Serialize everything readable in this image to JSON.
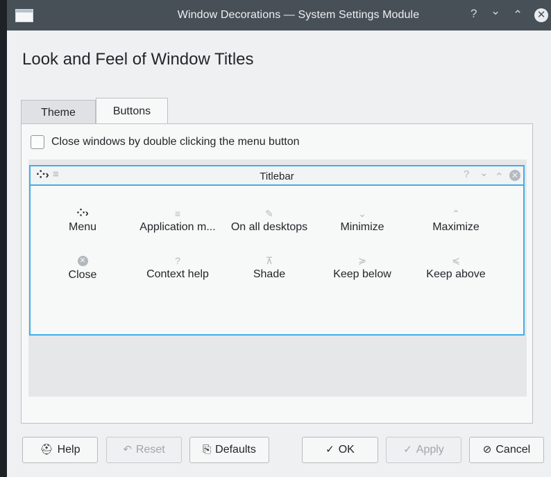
{
  "window": {
    "title": "Window Decorations — System Settings Module",
    "buttons": {
      "help": "?",
      "minimize": "⌄",
      "maximize": "⌃",
      "close": "✕"
    }
  },
  "heading": "Look and Feel of Window Titles",
  "tabs": [
    {
      "label": "Theme",
      "active": false
    },
    {
      "label": "Buttons",
      "active": true
    }
  ],
  "options": {
    "close_double_click": {
      "label": "Close windows by double clicking the menu button",
      "checked": false
    }
  },
  "titlebar_preview": {
    "label": "Titlebar",
    "left_buttons": [
      "menu-icon",
      "application-menu-icon"
    ],
    "right_buttons": [
      "context-help-icon",
      "minimize-icon",
      "maximize-icon",
      "close-icon"
    ],
    "glyphs": {
      "menu": "⁘›",
      "appmenu": "≡",
      "help": "?",
      "min": "⌄",
      "max": "⌃",
      "close": "✕"
    }
  },
  "available_buttons": [
    {
      "label": "Menu",
      "icon": "menu-icon",
      "glyph": "⁘›"
    },
    {
      "label": "Application m...",
      "icon": "application-menu-icon",
      "glyph": "≡"
    },
    {
      "label": "On all desktops",
      "icon": "pin-icon",
      "glyph": "✎"
    },
    {
      "label": "Minimize",
      "icon": "chevron-down-icon",
      "glyph": "⌄"
    },
    {
      "label": "Maximize",
      "icon": "chevron-up-icon",
      "glyph": "⌃"
    },
    {
      "label": "Close",
      "icon": "close-icon",
      "glyph": "✕"
    },
    {
      "label": "Context help",
      "icon": "help-icon",
      "glyph": "?"
    },
    {
      "label": "Shade",
      "icon": "shade-icon",
      "glyph": "⊼"
    },
    {
      "label": "Keep below",
      "icon": "keep-below-icon",
      "glyph": "≽"
    },
    {
      "label": "Keep above",
      "icon": "keep-above-icon",
      "glyph": "≼"
    }
  ],
  "footer": {
    "help": {
      "label": "Help",
      "glyph": "⛑"
    },
    "reset": {
      "label": "Reset",
      "glyph": "↶"
    },
    "defaults": {
      "label": "Defaults",
      "glyph": "⎘"
    },
    "ok": {
      "label": "OK",
      "glyph": "✓"
    },
    "apply": {
      "label": "Apply",
      "glyph": "✓"
    },
    "cancel": {
      "label": "Cancel",
      "glyph": "⊘"
    }
  },
  "colors": {
    "accent": "#3daee9",
    "titlebar": "#475057",
    "window_bg": "#eff0f1"
  }
}
